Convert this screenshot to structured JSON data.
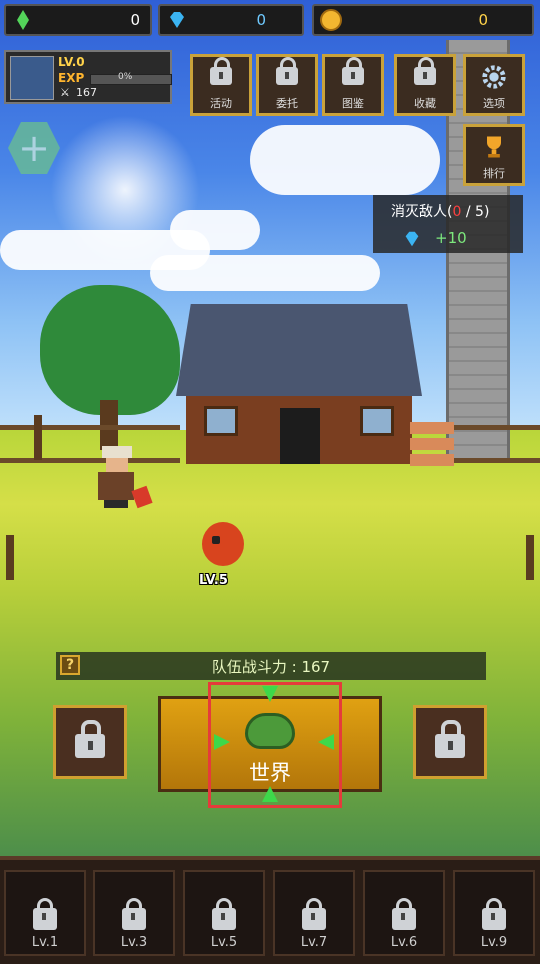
{
  "resources": [
    {
      "icon": "green-crystal-icon",
      "value": "0"
    },
    {
      "icon": "diamond-icon",
      "value": "0"
    },
    {
      "icon": "gold-coin-icon",
      "value": "0"
    }
  ],
  "profile": {
    "level": "LV.0",
    "exp_label": "EXP",
    "exp_percent": "0%",
    "power": "167"
  },
  "top_buttons": [
    {
      "label": "活动",
      "locked": true
    },
    {
      "label": "委托",
      "locked": true
    },
    {
      "label": "图鉴",
      "locked": true
    },
    {
      "label": "收藏",
      "locked": true
    },
    {
      "label": "选项",
      "locked": false
    },
    {
      "label": "排行",
      "locked": false
    }
  ],
  "mission": {
    "title": "消灭敌人",
    "progress_current": "0",
    "progress_total": "5",
    "reward": "+10"
  },
  "enemy": {
    "level": "LV.5"
  },
  "team": {
    "power_text": "队伍战斗力 : 167",
    "help_label": "?"
  },
  "world_button": {
    "label": "世界"
  },
  "bottom_slots": [
    {
      "label": "Lv.1"
    },
    {
      "label": "Lv.3"
    },
    {
      "label": "Lv.5"
    },
    {
      "label": "Lv.7"
    },
    {
      "label": "Lv.6"
    },
    {
      "label": "Lv.9"
    }
  ],
  "colors": {
    "accent_gold": "#d0a030",
    "highlight_red": "#e53b3b",
    "reward_green": "#7de87d",
    "enemy_count_red": "#ff4040"
  }
}
